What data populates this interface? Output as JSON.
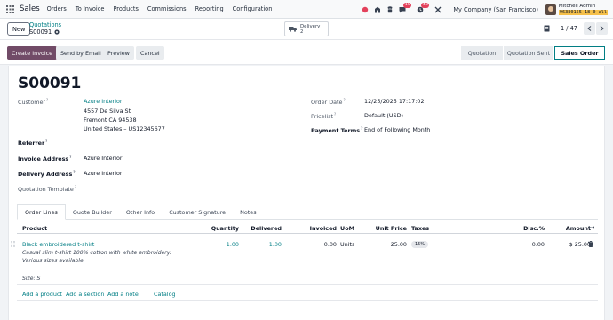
{
  "navbar": {
    "app_name": "Sales",
    "menu": [
      "Orders",
      "To Invoice",
      "Products",
      "Commissions",
      "Reporting",
      "Configuration"
    ],
    "badges": {
      "messages": "10",
      "activities": "48"
    },
    "company": "My Company (San Francisco)",
    "user_name": "Mitchell Admin",
    "db_name": "96380155-18-0-all"
  },
  "control": {
    "new_label": "New",
    "breadcrumb_parent": "Quotations",
    "breadcrumb_current": "S00091",
    "smart_button_title": "Delivery",
    "smart_button_count": "2",
    "pager": "1 / 47"
  },
  "statusbar": {
    "actions": [
      "Create Invoice",
      "Send by Email",
      "Preview",
      "Cancel"
    ],
    "stages": [
      "Quotation",
      "Quotation Sent",
      "Sales Order"
    ],
    "current_stage": "Sales Order"
  },
  "form": {
    "title": "S00091",
    "labels": {
      "customer": "Customer",
      "referrer": "Referrer",
      "invoice_address": "Invoice Address",
      "delivery_address": "Delivery Address",
      "quotation_template": "Quotation Template",
      "order_date": "Order Date",
      "pricelist": "Pricelist",
      "payment_terms": "Payment Terms"
    },
    "customer_name": "Azure Interior",
    "customer_address": [
      "4557 De Silva St",
      "Fremont CA 94538",
      "United States – US12345677"
    ],
    "invoice_address": "Azure Interior",
    "delivery_address": "Azure Interior",
    "order_date": "12/25/2025 17:17:02",
    "pricelist": "Default (USD)",
    "payment_terms": "End of Following Month"
  },
  "tabs": [
    "Order Lines",
    "Quote Builder",
    "Other Info",
    "Customer Signature",
    "Notes"
  ],
  "active_tab": "Order Lines",
  "order_lines": {
    "columns": [
      "Product",
      "Quantity",
      "Delivered",
      "Invoiced",
      "UoM",
      "Unit Price",
      "Taxes",
      "Disc.%",
      "Amount"
    ],
    "rows": [
      {
        "product": "Black embroidered t-shirt",
        "description": "Casual slim t-shirt 100% cotton with white embroidery. Various sizes available",
        "size": "Size: S",
        "quantity": "1.00",
        "delivered": "1.00",
        "invoiced": "0.00",
        "uom": "Units",
        "unit_price": "25.00",
        "taxes": "15%",
        "discount": "0.00",
        "amount": "$ 25.00"
      }
    ],
    "add_links": [
      "Add a product",
      "Add a section",
      "Add a note",
      "Catalog"
    ]
  }
}
